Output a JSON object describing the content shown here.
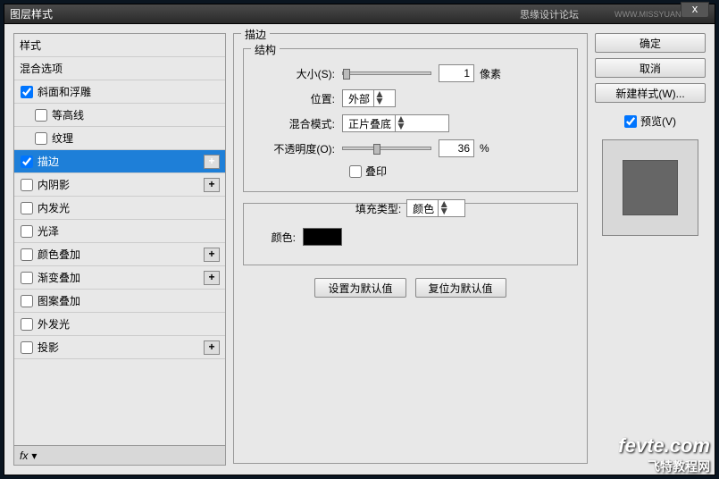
{
  "titlebar": {
    "title": "图层样式",
    "subtitle": "思缘设计论坛",
    "url": "WWW.MISSYUAN.COM"
  },
  "styles": {
    "header": "样式",
    "blend": "混合选项",
    "items": [
      {
        "label": "斜面和浮雕",
        "checked": true,
        "plus": false
      },
      {
        "label": "等高线",
        "checked": false,
        "plus": false,
        "indent": true
      },
      {
        "label": "纹理",
        "checked": false,
        "plus": false,
        "indent": true
      },
      {
        "label": "描边",
        "checked": true,
        "plus": true,
        "selected": true
      },
      {
        "label": "内阴影",
        "checked": false,
        "plus": true
      },
      {
        "label": "内发光",
        "checked": false,
        "plus": false
      },
      {
        "label": "光泽",
        "checked": false,
        "plus": false
      },
      {
        "label": "颜色叠加",
        "checked": false,
        "plus": true
      },
      {
        "label": "渐变叠加",
        "checked": false,
        "plus": true
      },
      {
        "label": "图案叠加",
        "checked": false,
        "plus": false
      },
      {
        "label": "外发光",
        "checked": false,
        "plus": false
      },
      {
        "label": "投影",
        "checked": false,
        "plus": true
      }
    ],
    "fx": "fx"
  },
  "stroke": {
    "title": "描边",
    "structure": "结构",
    "size_label": "大小(S):",
    "size": "1",
    "size_unit": "像素",
    "position_label": "位置:",
    "position": "外部",
    "blend_label": "混合模式:",
    "blend": "正片叠底",
    "opacity_label": "不透明度(O):",
    "opacity": "36",
    "opacity_unit": "%",
    "overprint": "叠印",
    "fill_label": "填充类型:",
    "fill": "颜色",
    "color_label": "颜色:",
    "btn_default": "设置为默认值",
    "btn_reset": "复位为默认值"
  },
  "right": {
    "ok": "确定",
    "cancel": "取消",
    "new_style": "新建样式(W)...",
    "preview": "预览(V)"
  },
  "watermark": {
    "main": "fevte.com",
    "sub": "飞特教程网"
  }
}
